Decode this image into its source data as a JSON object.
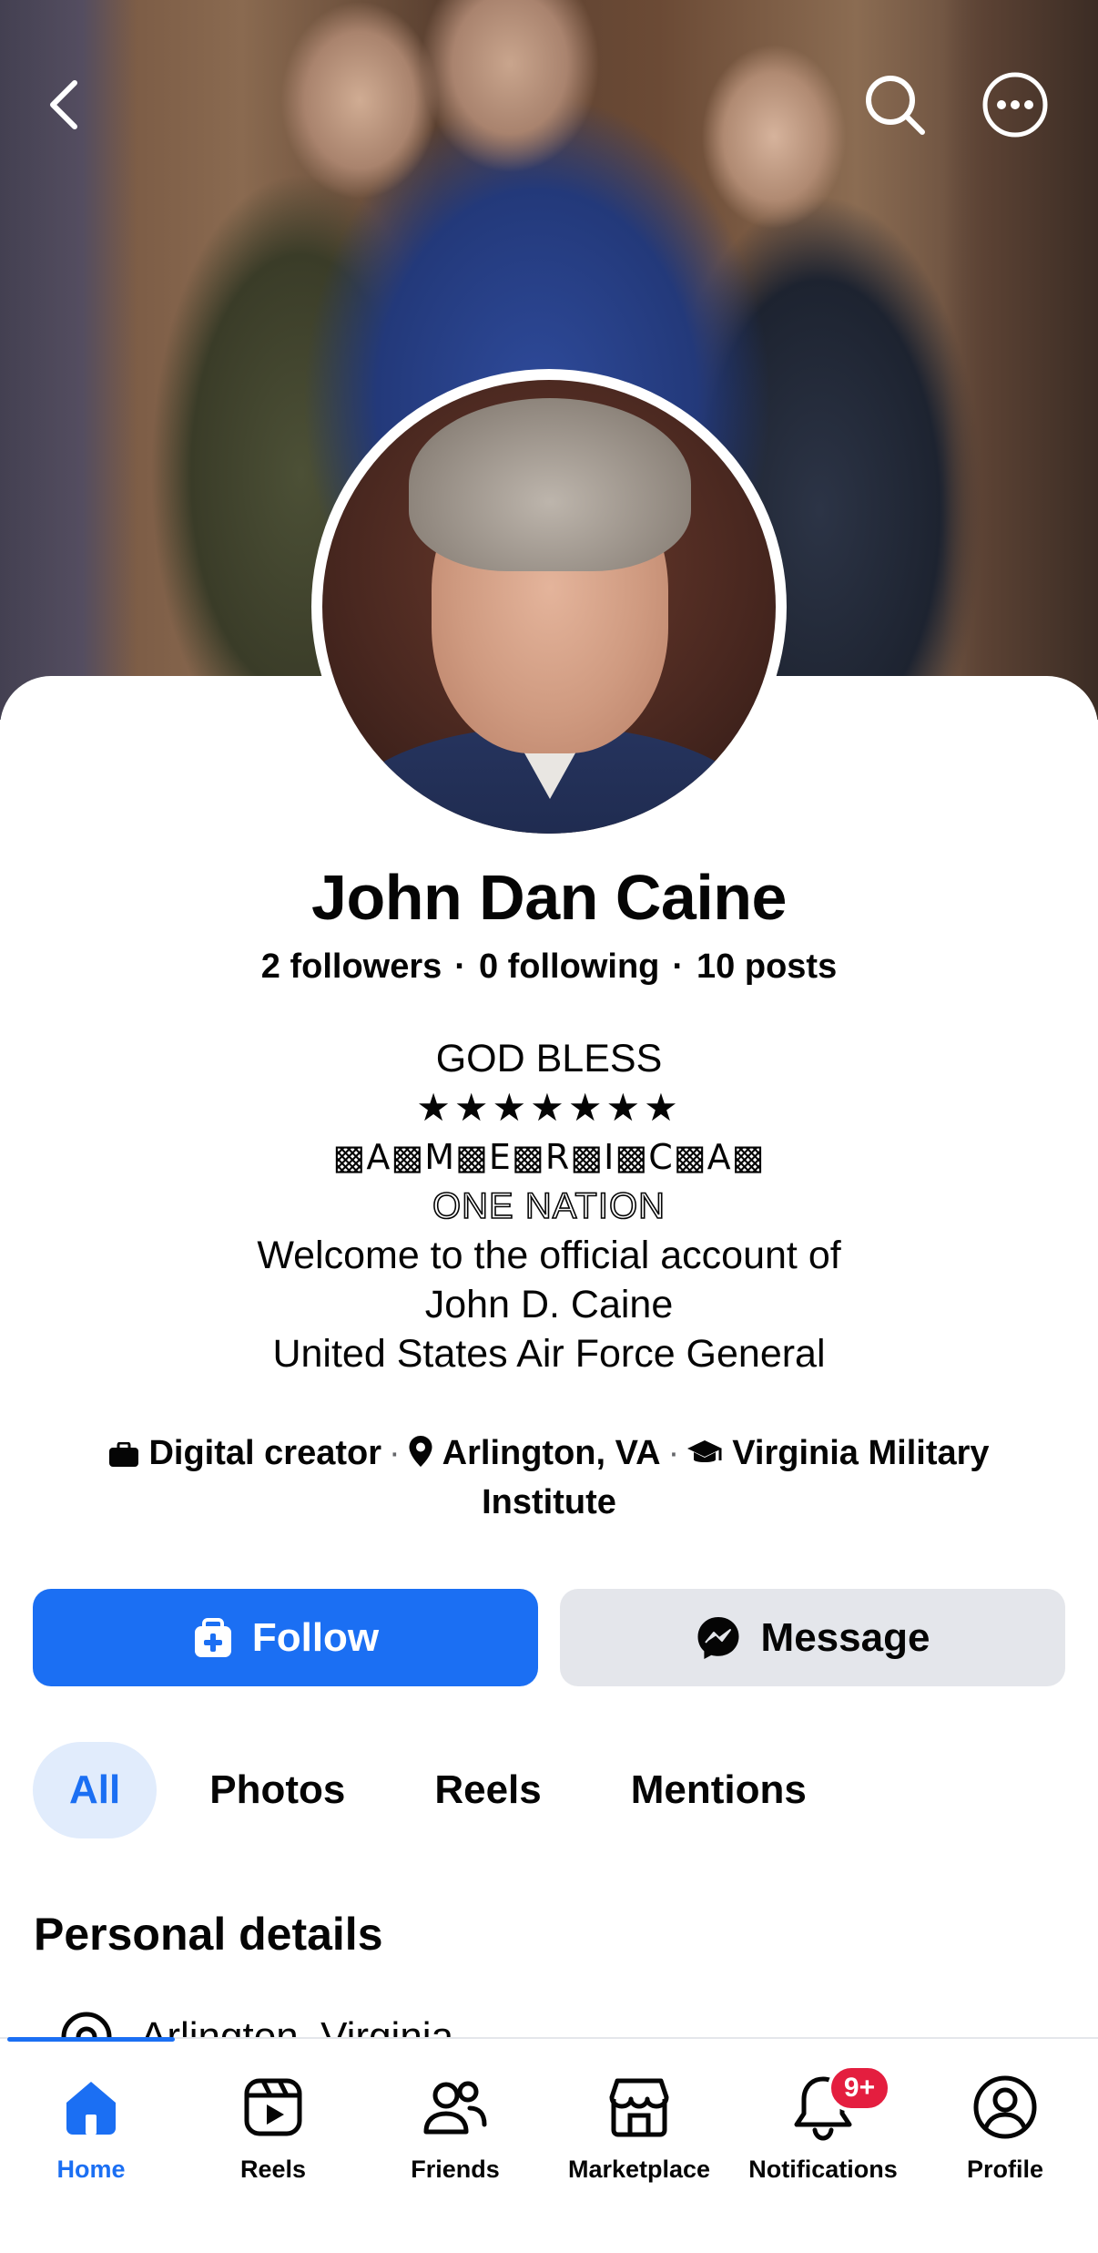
{
  "profile": {
    "name": "John Dan Caine",
    "stats": {
      "followers": "2 followers",
      "following": "0 following",
      "posts": "10 posts",
      "separator": "·"
    }
  },
  "bio": {
    "line1": "GOD BLESS",
    "line2": "★★★★★★★",
    "line3": "▩A▩M▩E▩R▩I▩C▩A▩",
    "line4": "ONE NATION",
    "line5": "Welcome to the official account of",
    "line6": "John D. Caine",
    "line7": "United States Air Force General"
  },
  "info": {
    "category": "Digital creator",
    "location": "Arlington, VA",
    "education": "Virginia Military Institute",
    "separator": "·"
  },
  "actions": {
    "follow": "Follow",
    "message": "Message"
  },
  "tabs": [
    {
      "label": "All",
      "active": true
    },
    {
      "label": "Photos",
      "active": false
    },
    {
      "label": "Reels",
      "active": false
    },
    {
      "label": "Mentions",
      "active": false
    }
  ],
  "personal_details": {
    "title": "Personal details",
    "location": "Arlington, Virginia"
  },
  "bottom_nav": [
    {
      "label": "Home",
      "icon": "home-icon",
      "active": true
    },
    {
      "label": "Reels",
      "icon": "reels-icon",
      "active": false
    },
    {
      "label": "Friends",
      "icon": "friends-icon",
      "active": false
    },
    {
      "label": "Marketplace",
      "icon": "marketplace-icon",
      "active": false
    },
    {
      "label": "Notifications",
      "icon": "bell-icon",
      "active": false,
      "badge": "9+"
    },
    {
      "label": "Profile",
      "icon": "profile-icon",
      "active": false
    }
  ],
  "colors": {
    "accent": "#1b6ff3",
    "badge": "#e41e3f",
    "secondary_button": "#e4e6eb",
    "active_tab_bg": "#e1ecfc",
    "text": "#050505"
  }
}
